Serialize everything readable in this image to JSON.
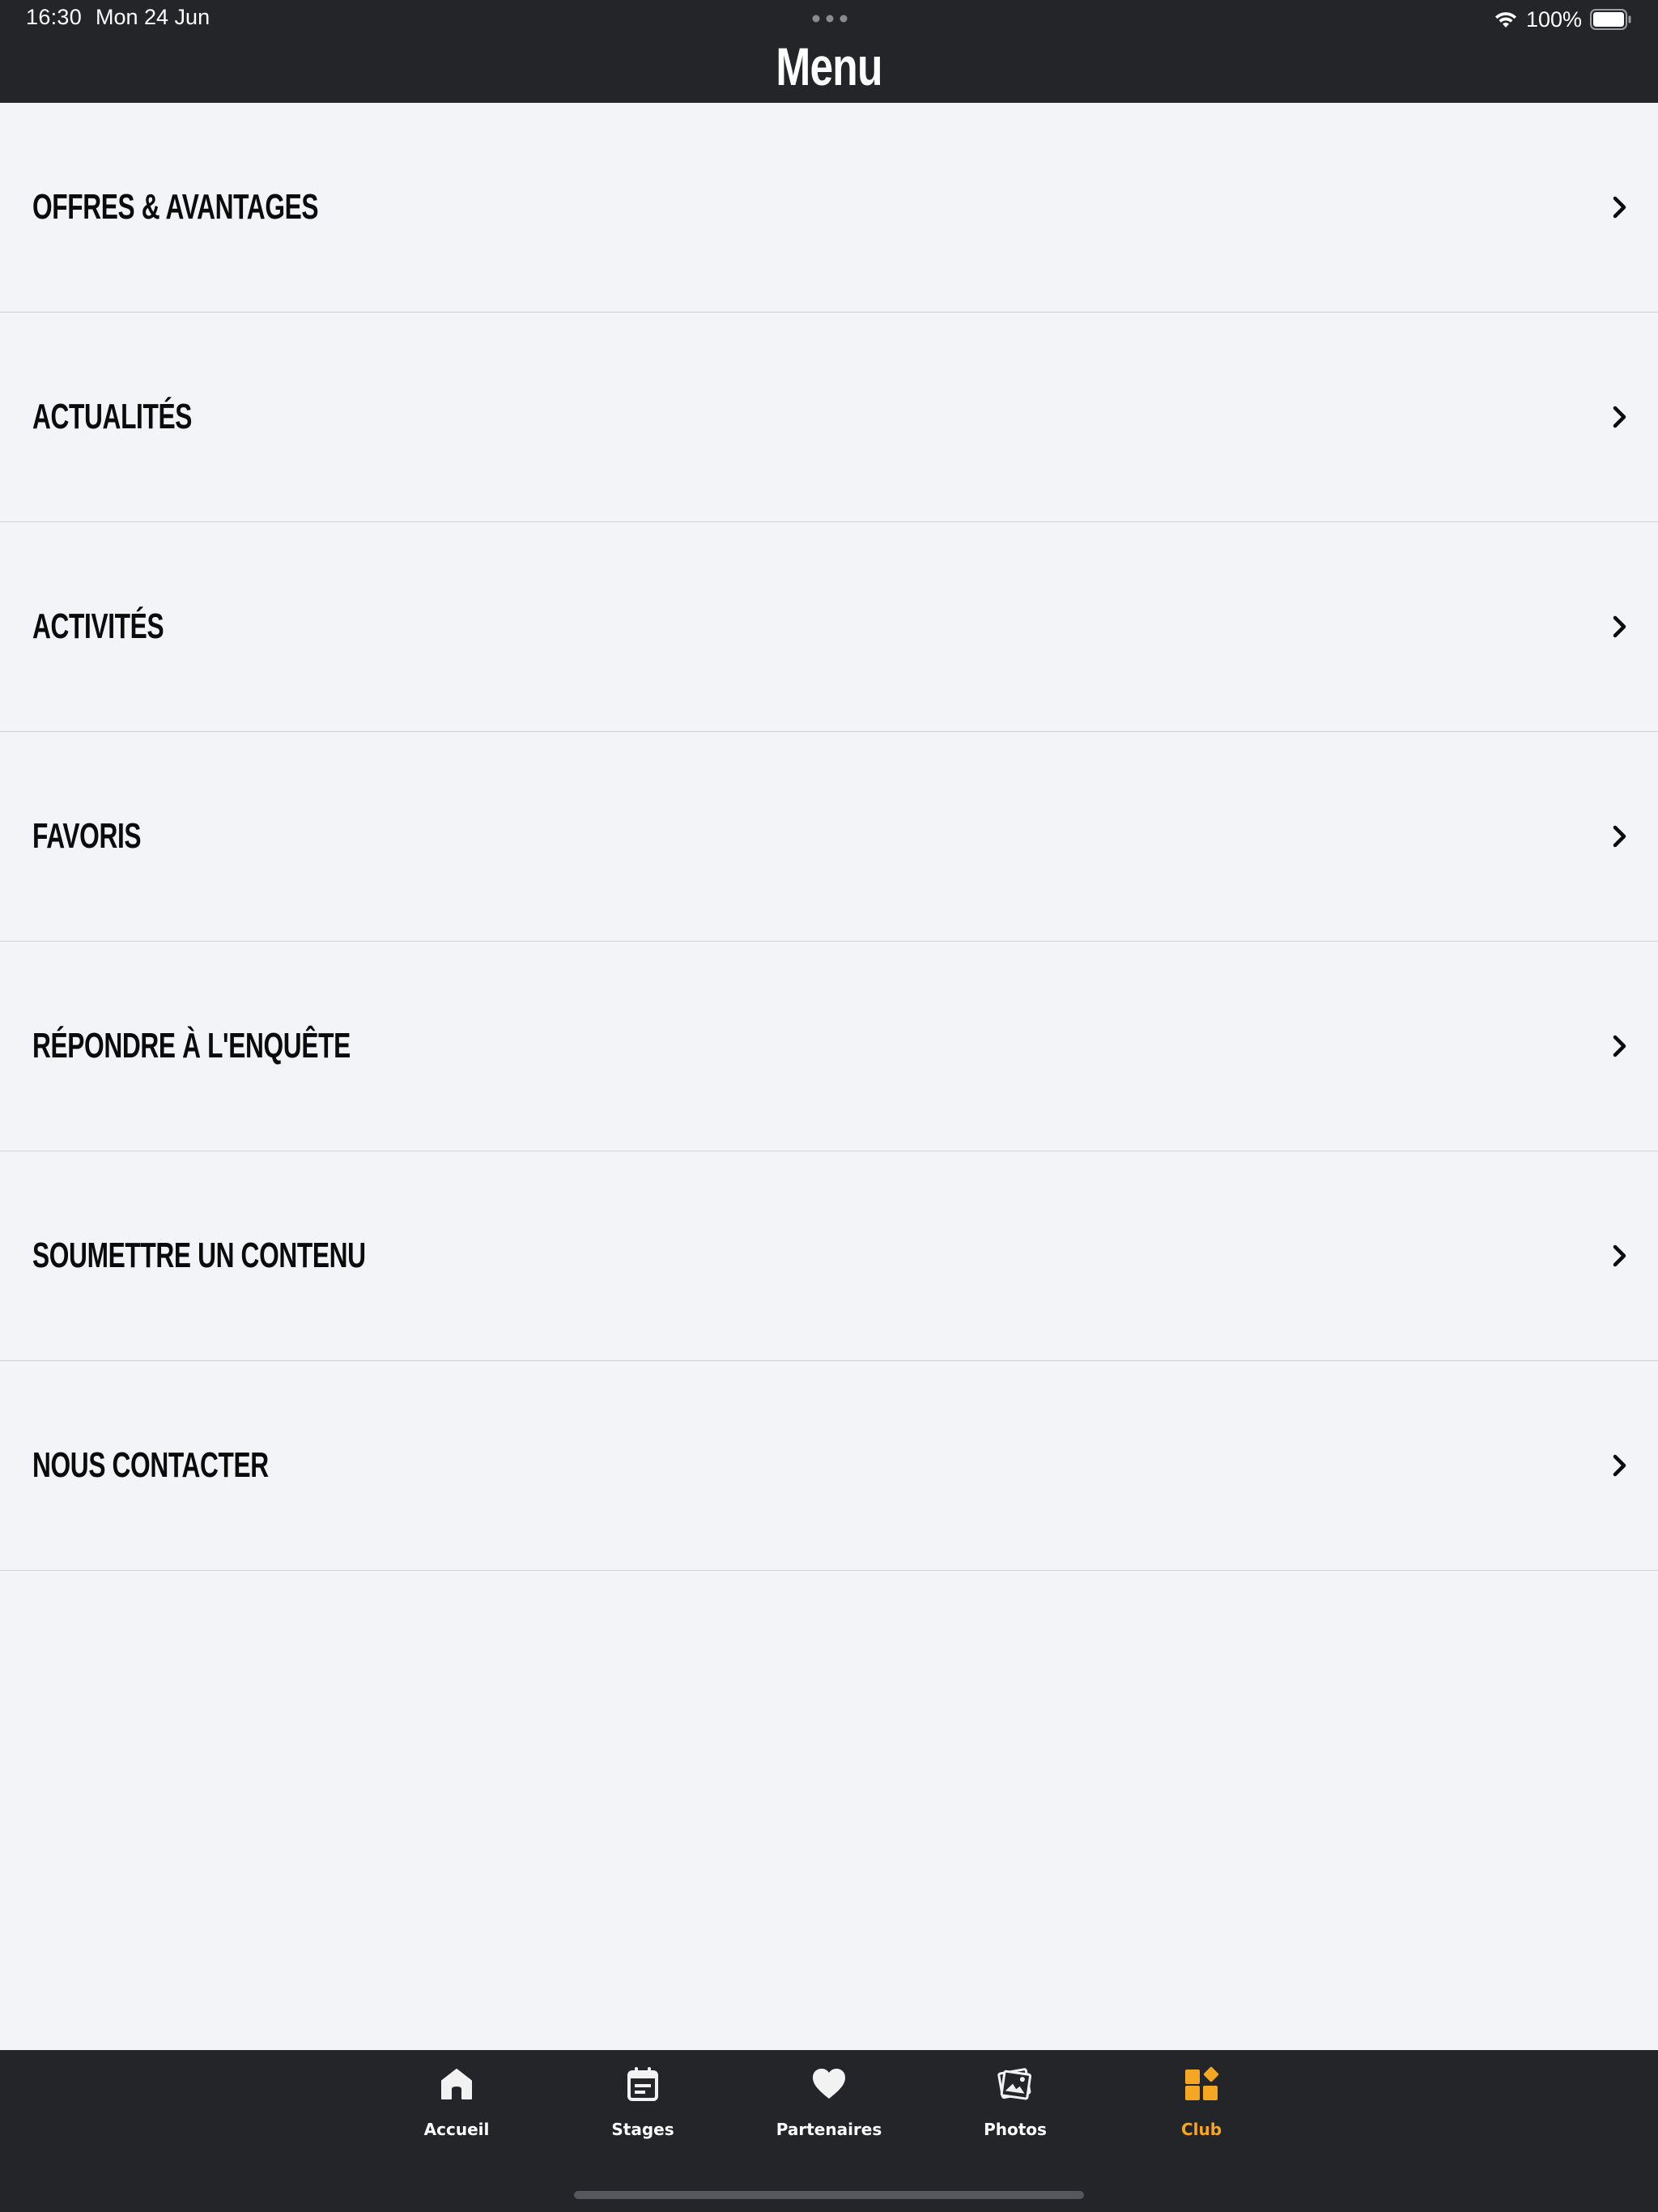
{
  "status_bar": {
    "time": "16:30",
    "date": "Mon 24 Jun",
    "battery": "100%"
  },
  "header": {
    "title": "Menu"
  },
  "menu": {
    "items": [
      {
        "label": "OFFRES & AVANTAGES"
      },
      {
        "label": "ACTUALITÉS"
      },
      {
        "label": "ACTIVITÉS"
      },
      {
        "label": "FAVORIS"
      },
      {
        "label": "RÉPONDRE À L'ENQUÊTE"
      },
      {
        "label": "SOUMETTRE UN CONTENU"
      },
      {
        "label": "NOUS CONTACTER"
      }
    ]
  },
  "tabbar": {
    "tabs": [
      {
        "label": "Accueil",
        "icon": "home-icon"
      },
      {
        "label": "Stages",
        "icon": "calendar-icon"
      },
      {
        "label": "Partenaires",
        "icon": "heart-icon"
      },
      {
        "label": "Photos",
        "icon": "photos-icon"
      },
      {
        "label": "Club",
        "icon": "club-grid-icon",
        "active": true
      }
    ]
  },
  "colors": {
    "bar_background": "#242528",
    "page_background": "#f2f4f8",
    "accent": "#f5a623",
    "divider": "#cfd1d5"
  }
}
